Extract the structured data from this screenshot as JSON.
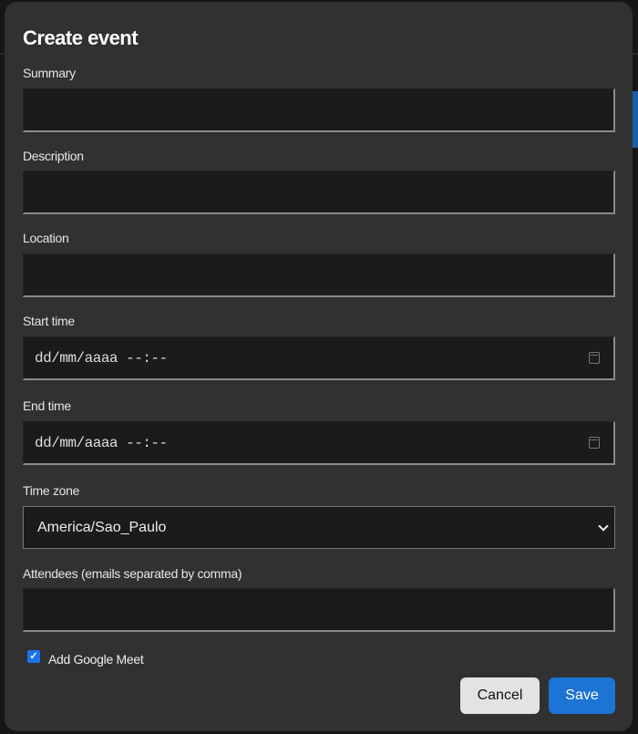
{
  "dialog": {
    "title": "Create event",
    "fields": {
      "summary": {
        "label": "Summary",
        "value": ""
      },
      "description": {
        "label": "Description",
        "value": ""
      },
      "location": {
        "label": "Location",
        "value": ""
      },
      "start_time": {
        "label": "Start time",
        "placeholder": "dd/mm/aaaa --:--"
      },
      "end_time": {
        "label": "End time",
        "placeholder": "dd/mm/aaaa --:--"
      },
      "time_zone": {
        "label": "Time zone",
        "selected": "America/Sao_Paulo"
      },
      "attendees": {
        "label": "Attendees (emails separated by comma)",
        "value": ""
      }
    },
    "google_meet": {
      "label": "Add Google Meet",
      "checked": true
    },
    "buttons": {
      "cancel": "Cancel",
      "save": "Save"
    }
  },
  "colors": {
    "accent": "#1c74d4",
    "dialog_bg": "#313131",
    "input_bg": "#1b1b1b"
  }
}
